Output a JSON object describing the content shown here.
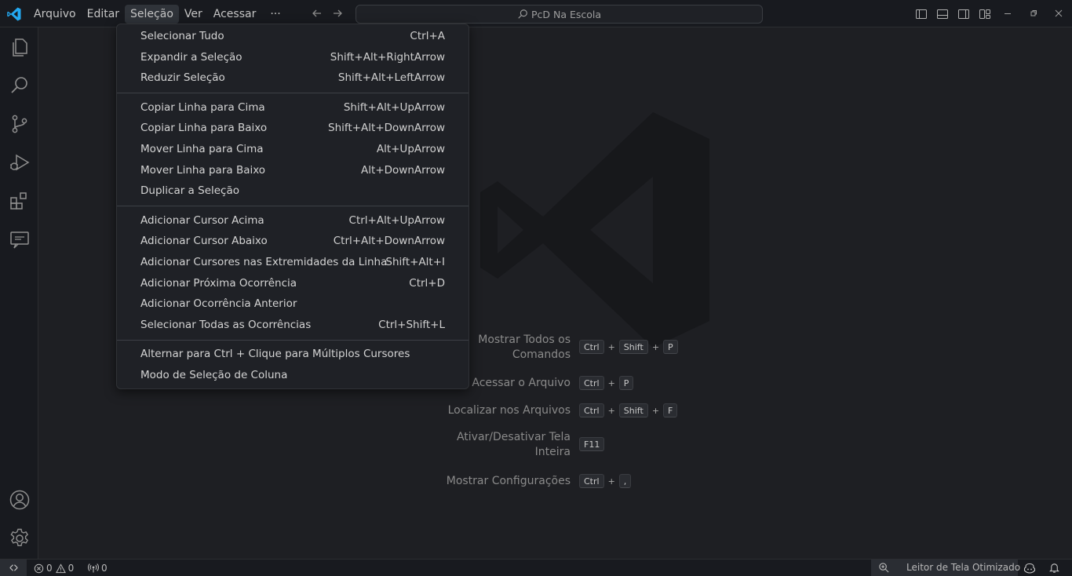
{
  "menubar": {
    "items": [
      "Arquivo",
      "Editar",
      "Seleção",
      "Ver",
      "Acessar",
      "···"
    ],
    "active_index": 2
  },
  "search": {
    "text": "PcD Na Escola"
  },
  "selection_menu": {
    "groups": [
      [
        {
          "label": "Selecionar Tudo",
          "shortcut": "Ctrl+A"
        },
        {
          "label": "Expandir a Seleção",
          "shortcut": "Shift+Alt+RightArrow"
        },
        {
          "label": "Reduzir Seleção",
          "shortcut": "Shift+Alt+LeftArrow"
        }
      ],
      [
        {
          "label": "Copiar Linha para Cima",
          "shortcut": "Shift+Alt+UpArrow"
        },
        {
          "label": "Copiar Linha para Baixo",
          "shortcut": "Shift+Alt+DownArrow"
        },
        {
          "label": "Mover Linha para Cima",
          "shortcut": "Alt+UpArrow"
        },
        {
          "label": "Mover Linha para Baixo",
          "shortcut": "Alt+DownArrow"
        },
        {
          "label": "Duplicar a Seleção",
          "shortcut": ""
        }
      ],
      [
        {
          "label": "Adicionar Cursor Acima",
          "shortcut": "Ctrl+Alt+UpArrow"
        },
        {
          "label": "Adicionar Cursor Abaixo",
          "shortcut": "Ctrl+Alt+DownArrow"
        },
        {
          "label": "Adicionar Cursores nas Extremidades da Linha",
          "shortcut": "Shift+Alt+I"
        },
        {
          "label": "Adicionar Próxima Ocorrência",
          "shortcut": "Ctrl+D"
        },
        {
          "label": "Adicionar Ocorrência Anterior",
          "shortcut": ""
        },
        {
          "label": "Selecionar Todas as Ocorrências",
          "shortcut": "Ctrl+Shift+L"
        }
      ],
      [
        {
          "label": "Alternar para Ctrl + Clique para Múltiplos Cursores",
          "shortcut": ""
        },
        {
          "label": "Modo de Seleção de Coluna",
          "shortcut": ""
        }
      ]
    ]
  },
  "watermark_shortcuts": [
    {
      "label_lines": [
        "Mostrar Todos os",
        "Comandos"
      ],
      "keys": [
        "Ctrl",
        "Shift",
        "P"
      ]
    },
    {
      "label_lines": [
        "Acessar o Arquivo"
      ],
      "keys": [
        "Ctrl",
        "P"
      ]
    },
    {
      "label_lines": [
        "Localizar nos Arquivos"
      ],
      "keys": [
        "Ctrl",
        "Shift",
        "F"
      ]
    },
    {
      "label_lines": [
        "Ativar/Desativar Tela",
        "Inteira"
      ],
      "keys": [
        "F11"
      ]
    },
    {
      "label_lines": [
        "Mostrar Configurações"
      ],
      "keys": [
        "Ctrl",
        ","
      ]
    }
  ],
  "statusbar": {
    "errors": "0",
    "warnings": "0",
    "ports": "0",
    "screen_reader": "Leitor de Tela Otimizado"
  },
  "colors": {
    "accent_logo": "#23a9f2",
    "background": "#181a1f",
    "editor": "#1e1f23",
    "menu": "#1f2126"
  }
}
